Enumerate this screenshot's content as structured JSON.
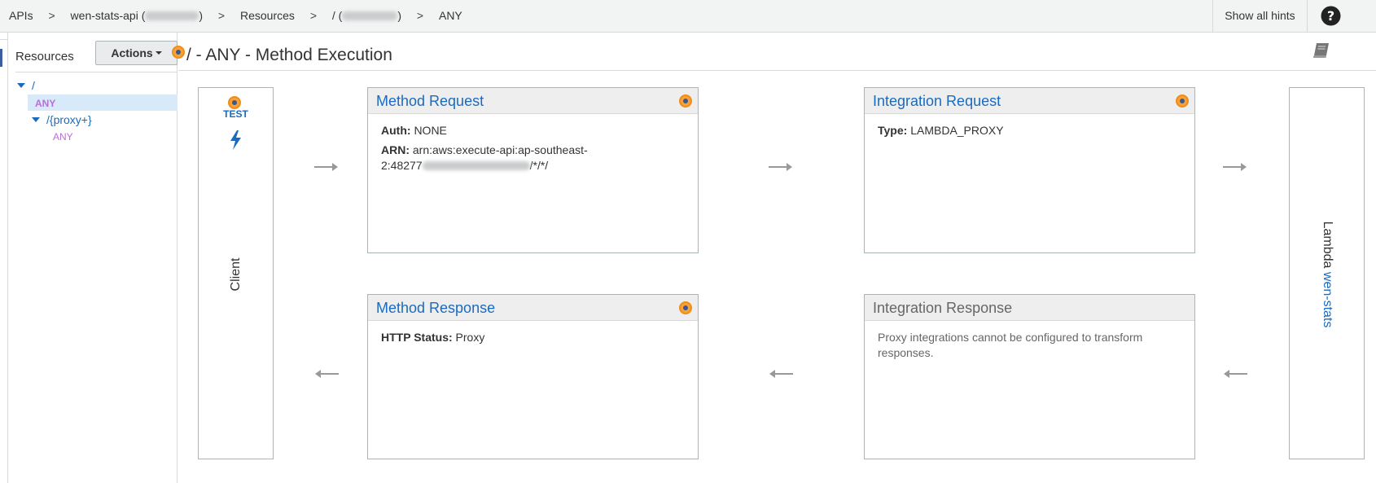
{
  "breadcrumb": {
    "apis": "APIs",
    "api_name": "wen-stats-api (",
    "api_name_close": ")",
    "resources": "Resources",
    "resource_path": "/ (",
    "resource_path_close": ")",
    "method": "ANY",
    "separator": ">"
  },
  "header": {
    "show_hints_label": "Show all hints",
    "help_icon": "question-circle-icon"
  },
  "sidebar": {
    "title": "Resources",
    "actions_label": "Actions",
    "tree": [
      {
        "label": "/",
        "expanded": true
      },
      {
        "label": "ANY",
        "selected": true
      },
      {
        "label": "/{proxy+}",
        "expanded": true
      },
      {
        "label": "ANY"
      }
    ]
  },
  "main": {
    "title": "/ - ANY - Method Execution",
    "doc_icon": "book-icon"
  },
  "client": {
    "test_label": "TEST",
    "test_icon": "lightning-bolt-icon",
    "label": "Client"
  },
  "method_request": {
    "title": "Method Request",
    "auth_key": "Auth:",
    "auth_value": "NONE",
    "arn_key": "ARN:",
    "arn_value_line1": "arn:aws:execute-api:ap-southeast-",
    "arn_value_line2_prefix": "2:48277",
    "arn_value_line2_suffix": "/*/*/"
  },
  "integration_request": {
    "title": "Integration Request",
    "type_key": "Type:",
    "type_value": "LAMBDA_PROXY"
  },
  "method_response": {
    "title": "Method Response",
    "status_key": "HTTP Status:",
    "status_value": "Proxy"
  },
  "integration_response": {
    "title": "Integration Response",
    "message": "Proxy integrations cannot be configured to transform responses."
  },
  "lambda": {
    "prefix": "Lambda",
    "function_name": "wen-stats"
  },
  "colors": {
    "link": "#1a6bbf",
    "hint_dot": "#f7a13b",
    "method_tag": "#b86fd4",
    "selected_row": "#d8e9fa"
  }
}
